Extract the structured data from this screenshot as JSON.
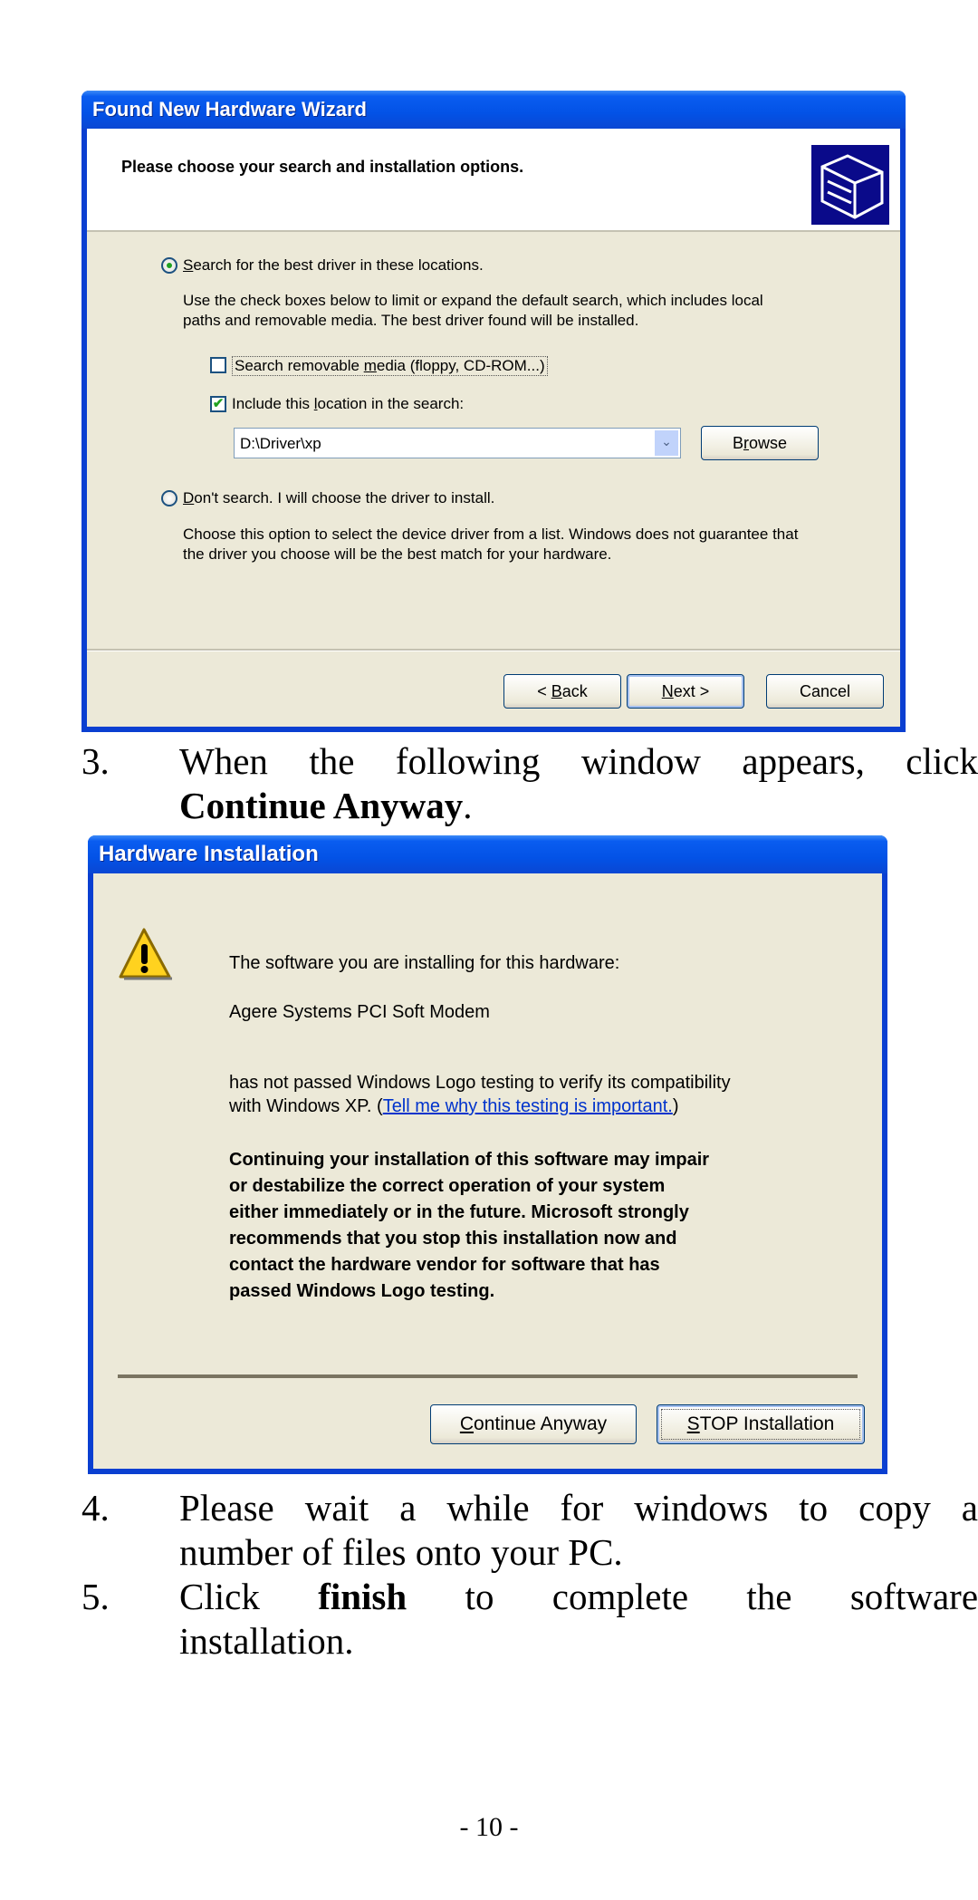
{
  "wizard": {
    "title": "Found New Hardware Wizard",
    "header_title": "Please choose your search and installation options.",
    "option_search": {
      "label_u": "S",
      "label_rest": "earch for the best driver in these locations.",
      "selected": true
    },
    "search_desc_1": "Use the check boxes below to limit or expand the default search, which includes local",
    "search_desc_2": "paths and removable media. The best driver found will be installed.",
    "check_removable": {
      "label_a": "Search removable ",
      "label_u": "m",
      "label_b": "edia (floppy, CD-ROM...)",
      "checked": false
    },
    "check_location": {
      "label_a": "Include this ",
      "label_u": "l",
      "label_b": "ocation in the search:",
      "checked": true
    },
    "location_value": "D:\\Driver\\xp",
    "browse": {
      "a": "B",
      "u": "r",
      "b": "owse"
    },
    "option_dont": {
      "label_u": "D",
      "label_rest": "on't search. I will choose the driver to install.",
      "selected": false
    },
    "dont_desc_1": "Choose this option to select the device driver from a list.  Windows does not guarantee that",
    "dont_desc_2": "the driver you choose will be the best match for your hardware.",
    "back": {
      "a": "< ",
      "u": "B",
      "b": "ack"
    },
    "next": {
      "u": "N",
      "b": "ext >"
    },
    "cancel": "Cancel"
  },
  "step3": {
    "num": "3.",
    "text": "When the following window appears, click",
    "bold": "Continue Anyway",
    "end": "."
  },
  "hardware": {
    "title": "Hardware Installation",
    "line1": "The software you are installing for this hardware:",
    "device": "Agere Systems PCI Soft Modem",
    "line2a": "has not passed Windows Logo testing to verify its compatibility",
    "line2b": "with Windows XP. (",
    "link": "Tell me why this testing is important.",
    "line2c": ")",
    "warning": [
      "Continuing your installation of this software may impair",
      "or destabilize the correct operation of your system",
      "either immediately or in the future. Microsoft strongly",
      "recommends that you stop this installation now and",
      "contact the hardware vendor for software that has",
      "passed Windows Logo testing."
    ],
    "continue": {
      "u": "C",
      "b": "ontinue Anyway"
    },
    "stop": {
      "u": "S",
      "b": "TOP Installation"
    }
  },
  "step4": {
    "num": "4.",
    "line1": "Please wait a while for windows to copy a",
    "line2": "number of files onto your PC."
  },
  "step5": {
    "num": "5.",
    "a": "Click",
    "bold": "finish",
    "b": "to complete the software",
    "line2": "installation."
  },
  "page_number": "- 10 -"
}
